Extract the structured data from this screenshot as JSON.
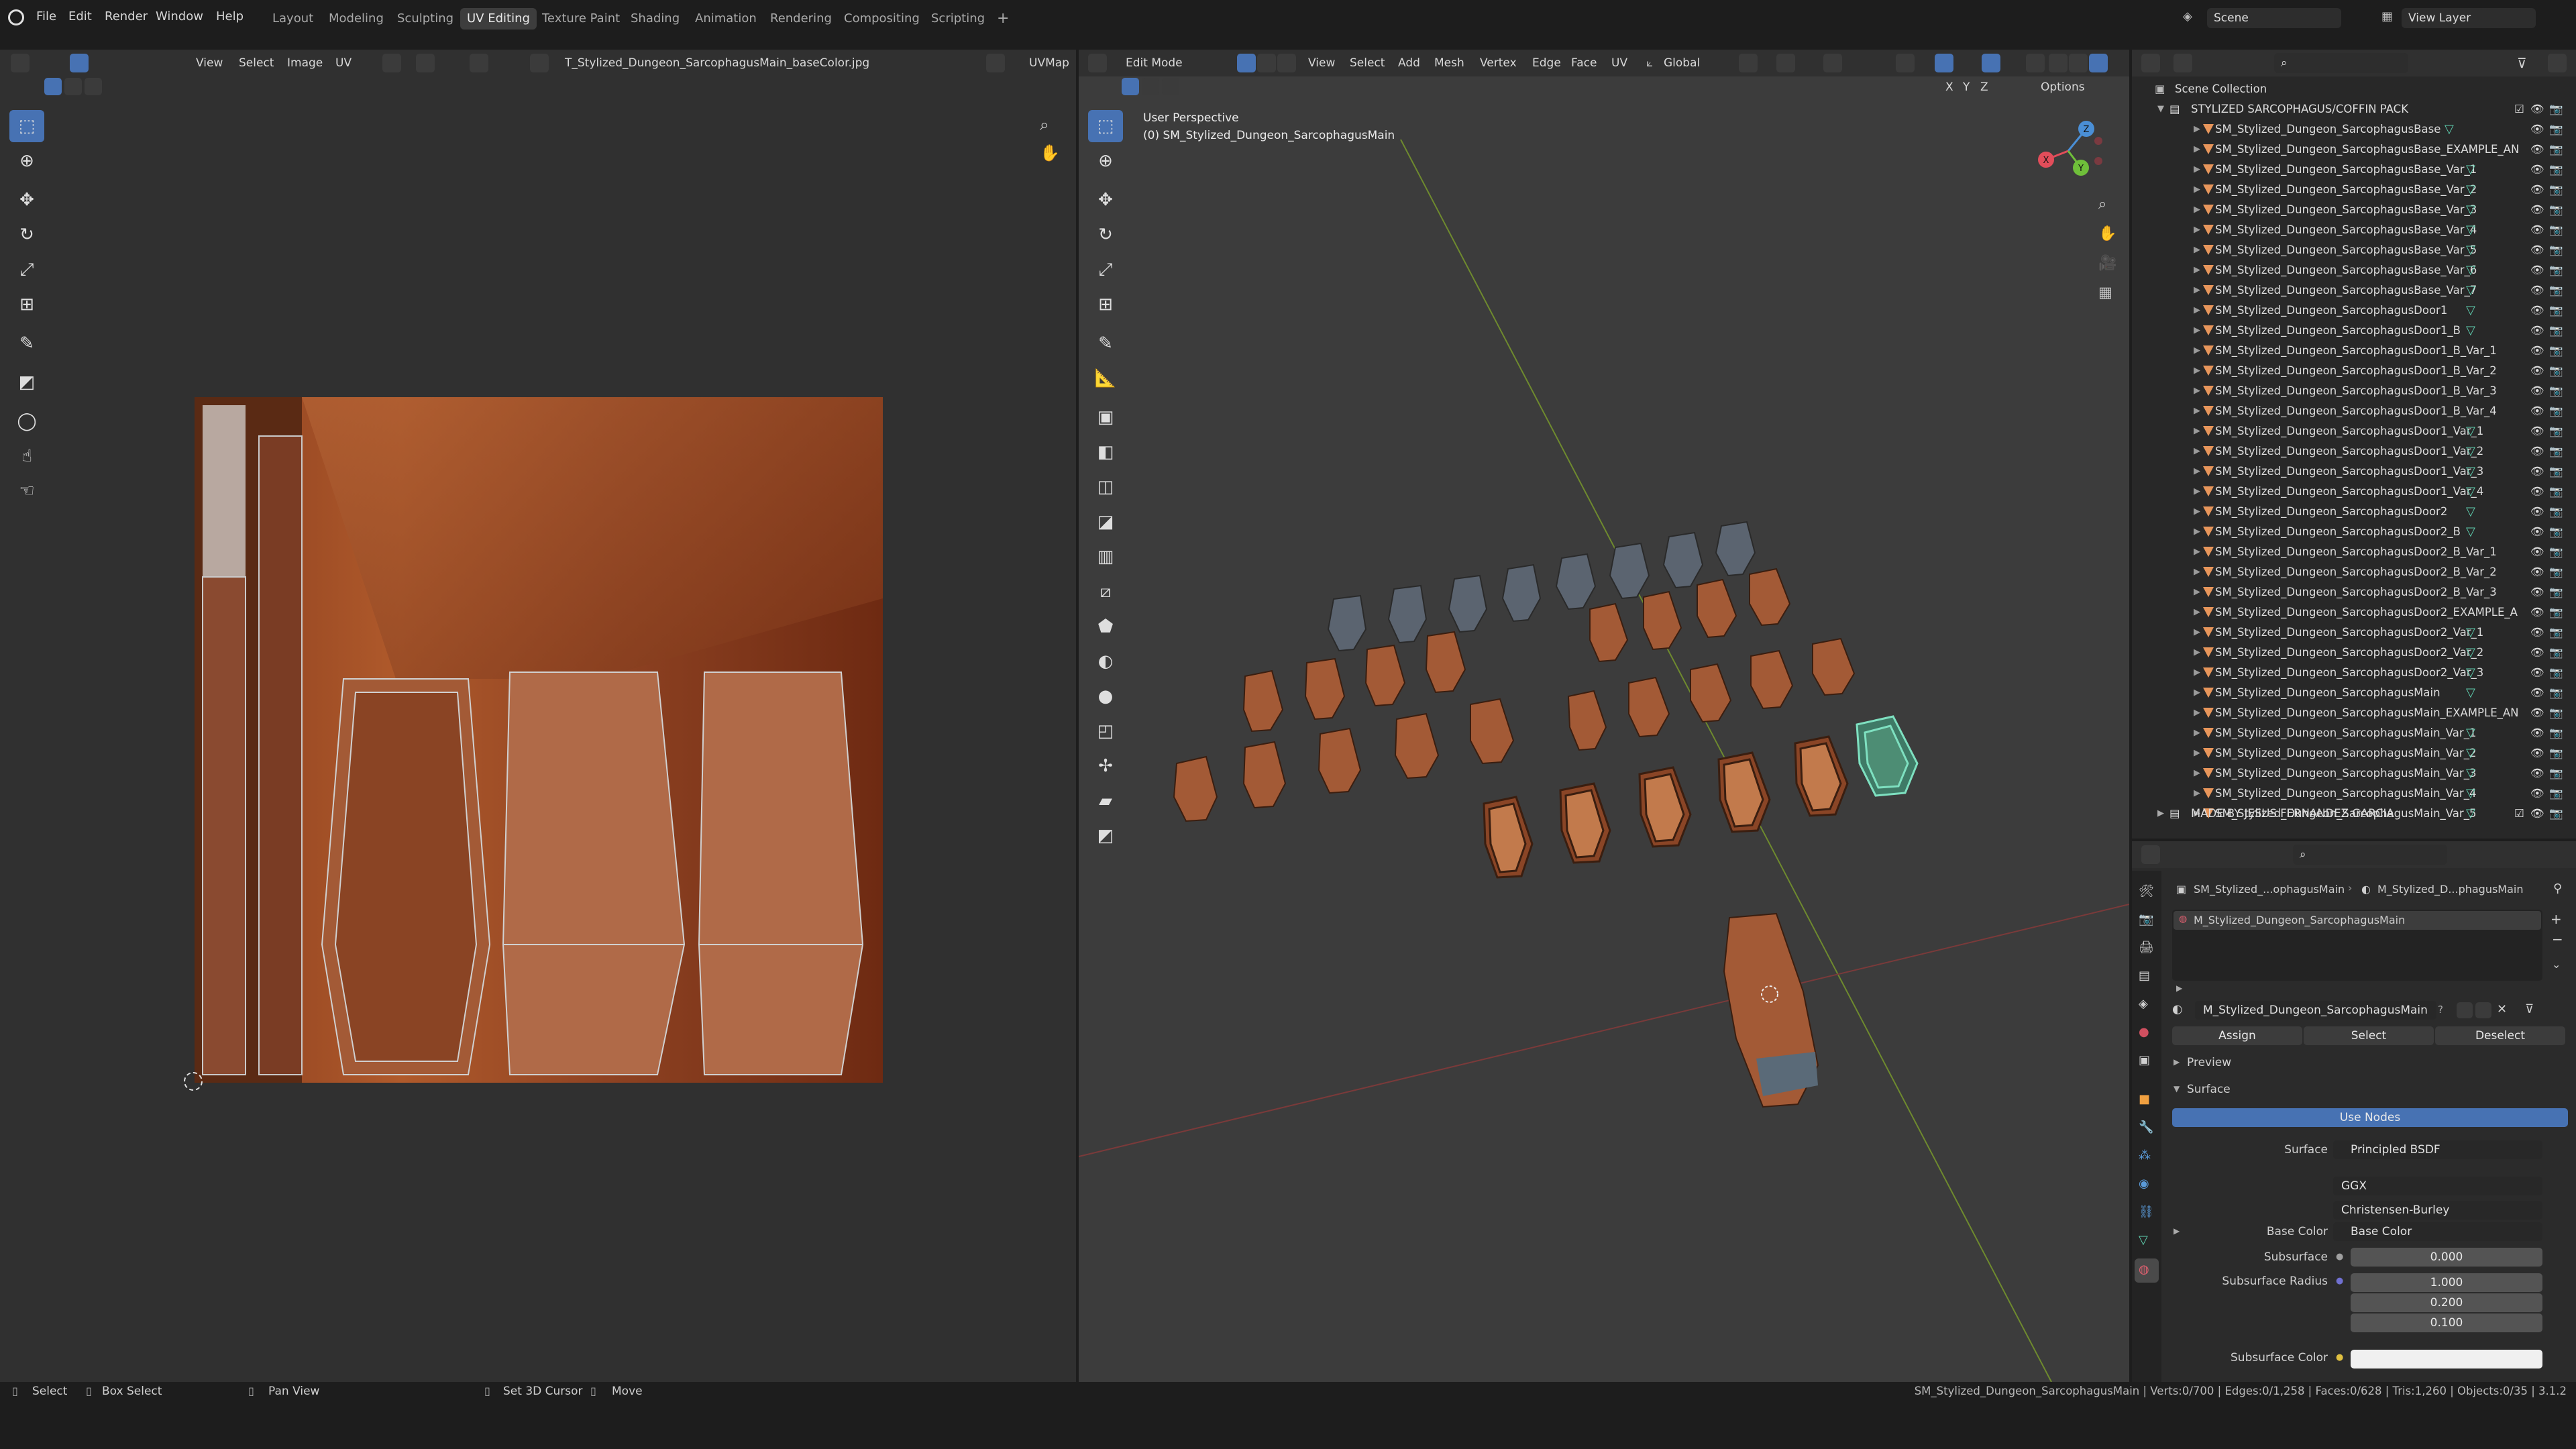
{
  "menus": [
    "File",
    "Edit",
    "Render",
    "Window",
    "Help"
  ],
  "workspaces": [
    "Layout",
    "Modeling",
    "Sculpting",
    "UV Editing",
    "Texture Paint",
    "Shading",
    "Animation",
    "Rendering",
    "Compositing",
    "Scripting"
  ],
  "active_workspace": "UV Editing",
  "scene": {
    "label": "Scene",
    "view_layer": "View Layer"
  },
  "uv_editor": {
    "menus": [
      "View",
      "Select",
      "Image",
      "UV"
    ],
    "image_name": "T_Stylized_Dungeon_SarcophagusMain_baseColor.jpg",
    "uvmap": "UVMap"
  },
  "viewport": {
    "mode": "Edit Mode",
    "menus": [
      "View",
      "Select",
      "Add",
      "Mesh",
      "Vertex",
      "Edge",
      "Face",
      "UV"
    ],
    "orientation": "Global",
    "options": "Options",
    "axes": [
      "X",
      "Y",
      "Z"
    ],
    "overlay_title": "User Perspective",
    "overlay_object": "(0) SM_Stylized_Dungeon_SarcophagusMain",
    "gizmo_labels": [
      "X",
      "Y",
      "Z"
    ]
  },
  "outliner": {
    "collection_root": "Scene Collection",
    "pack": "STYLIZED SARCOPHAGUS/COFFIN PACK",
    "items": [
      "SM_Stylized_Dungeon_SarcophagusBase",
      "SM_Stylized_Dungeon_SarcophagusBase_EXAMPLE_AN",
      "SM_Stylized_Dungeon_SarcophagusBase_Var_1",
      "SM_Stylized_Dungeon_SarcophagusBase_Var_2",
      "SM_Stylized_Dungeon_SarcophagusBase_Var_3",
      "SM_Stylized_Dungeon_SarcophagusBase_Var_4",
      "SM_Stylized_Dungeon_SarcophagusBase_Var_5",
      "SM_Stylized_Dungeon_SarcophagusBase_Var_6",
      "SM_Stylized_Dungeon_SarcophagusBase_Var_7",
      "SM_Stylized_Dungeon_SarcophagusDoor1",
      "SM_Stylized_Dungeon_SarcophagusDoor1_B",
      "SM_Stylized_Dungeon_SarcophagusDoor1_B_Var_1",
      "SM_Stylized_Dungeon_SarcophagusDoor1_B_Var_2",
      "SM_Stylized_Dungeon_SarcophagusDoor1_B_Var_3",
      "SM_Stylized_Dungeon_SarcophagusDoor1_B_Var_4",
      "SM_Stylized_Dungeon_SarcophagusDoor1_Var_1",
      "SM_Stylized_Dungeon_SarcophagusDoor1_Var_2",
      "SM_Stylized_Dungeon_SarcophagusDoor1_Var_3",
      "SM_Stylized_Dungeon_SarcophagusDoor1_Var_4",
      "SM_Stylized_Dungeon_SarcophagusDoor2",
      "SM_Stylized_Dungeon_SarcophagusDoor2_B",
      "SM_Stylized_Dungeon_SarcophagusDoor2_B_Var_1",
      "SM_Stylized_Dungeon_SarcophagusDoor2_B_Var_2",
      "SM_Stylized_Dungeon_SarcophagusDoor2_B_Var_3",
      "SM_Stylized_Dungeon_SarcophagusDoor2_EXAMPLE_A",
      "SM_Stylized_Dungeon_SarcophagusDoor2_Var_1",
      "SM_Stylized_Dungeon_SarcophagusDoor2_Var_2",
      "SM_Stylized_Dungeon_SarcophagusDoor2_Var_3",
      "SM_Stylized_Dungeon_SarcophagusMain",
      "SM_Stylized_Dungeon_SarcophagusMain_EXAMPLE_AN",
      "SM_Stylized_Dungeon_SarcophagusMain_Var_1",
      "SM_Stylized_Dungeon_SarcophagusMain_Var_2",
      "SM_Stylized_Dungeon_SarcophagusMain_Var_3",
      "SM_Stylized_Dungeon_SarcophagusMain_Var_4",
      "SM_Stylized_Dungeon_SarcophagusMain_Var_5"
    ],
    "footer": "MADE BY JESUS FERNANDEZ GARCIA"
  },
  "properties": {
    "breadcrumb_object": "SM_Stylized_...ophagusMain",
    "breadcrumb_material": "M_Stylized_D...phagusMain",
    "slot": "M_Stylized_Dungeon_SarcophagusMain",
    "material_name": "M_Stylized_Dungeon_SarcophagusMain",
    "assign": "Assign",
    "select": "Select",
    "deselect": "Deselect",
    "preview": "Preview",
    "surface_panel": "Surface",
    "use_nodes": "Use Nodes",
    "surface_label": "Surface",
    "surface_value": "Principled BSDF",
    "distribution": "GGX",
    "subsurface_method": "Christensen-Burley",
    "base_color_label": "Base Color",
    "base_color_value": "Base Color",
    "subsurface_label": "Subsurface",
    "subsurface_value": "0.000",
    "subsurface_radius_label": "Subsurface Radius",
    "subsurface_radius": [
      "1.000",
      "0.200",
      "0.100"
    ],
    "subsurface_color_label": "Subsurface Color"
  },
  "status": {
    "select": "Select",
    "box_select": "Box Select",
    "pan_view": "Pan View",
    "set_cursor": "Set 3D Cursor",
    "move": "Move",
    "stats": "SM_Stylized_Dungeon_SarcophagusMain | Verts:0/700 | Edges:0/1,258 | Faces:0/628 | Tris:1,260 | Objects:0/35 | 3.1.2"
  },
  "colors": {
    "accent": "#4772b3",
    "selection": "#5fd0b0",
    "wood": "#a0522d"
  }
}
